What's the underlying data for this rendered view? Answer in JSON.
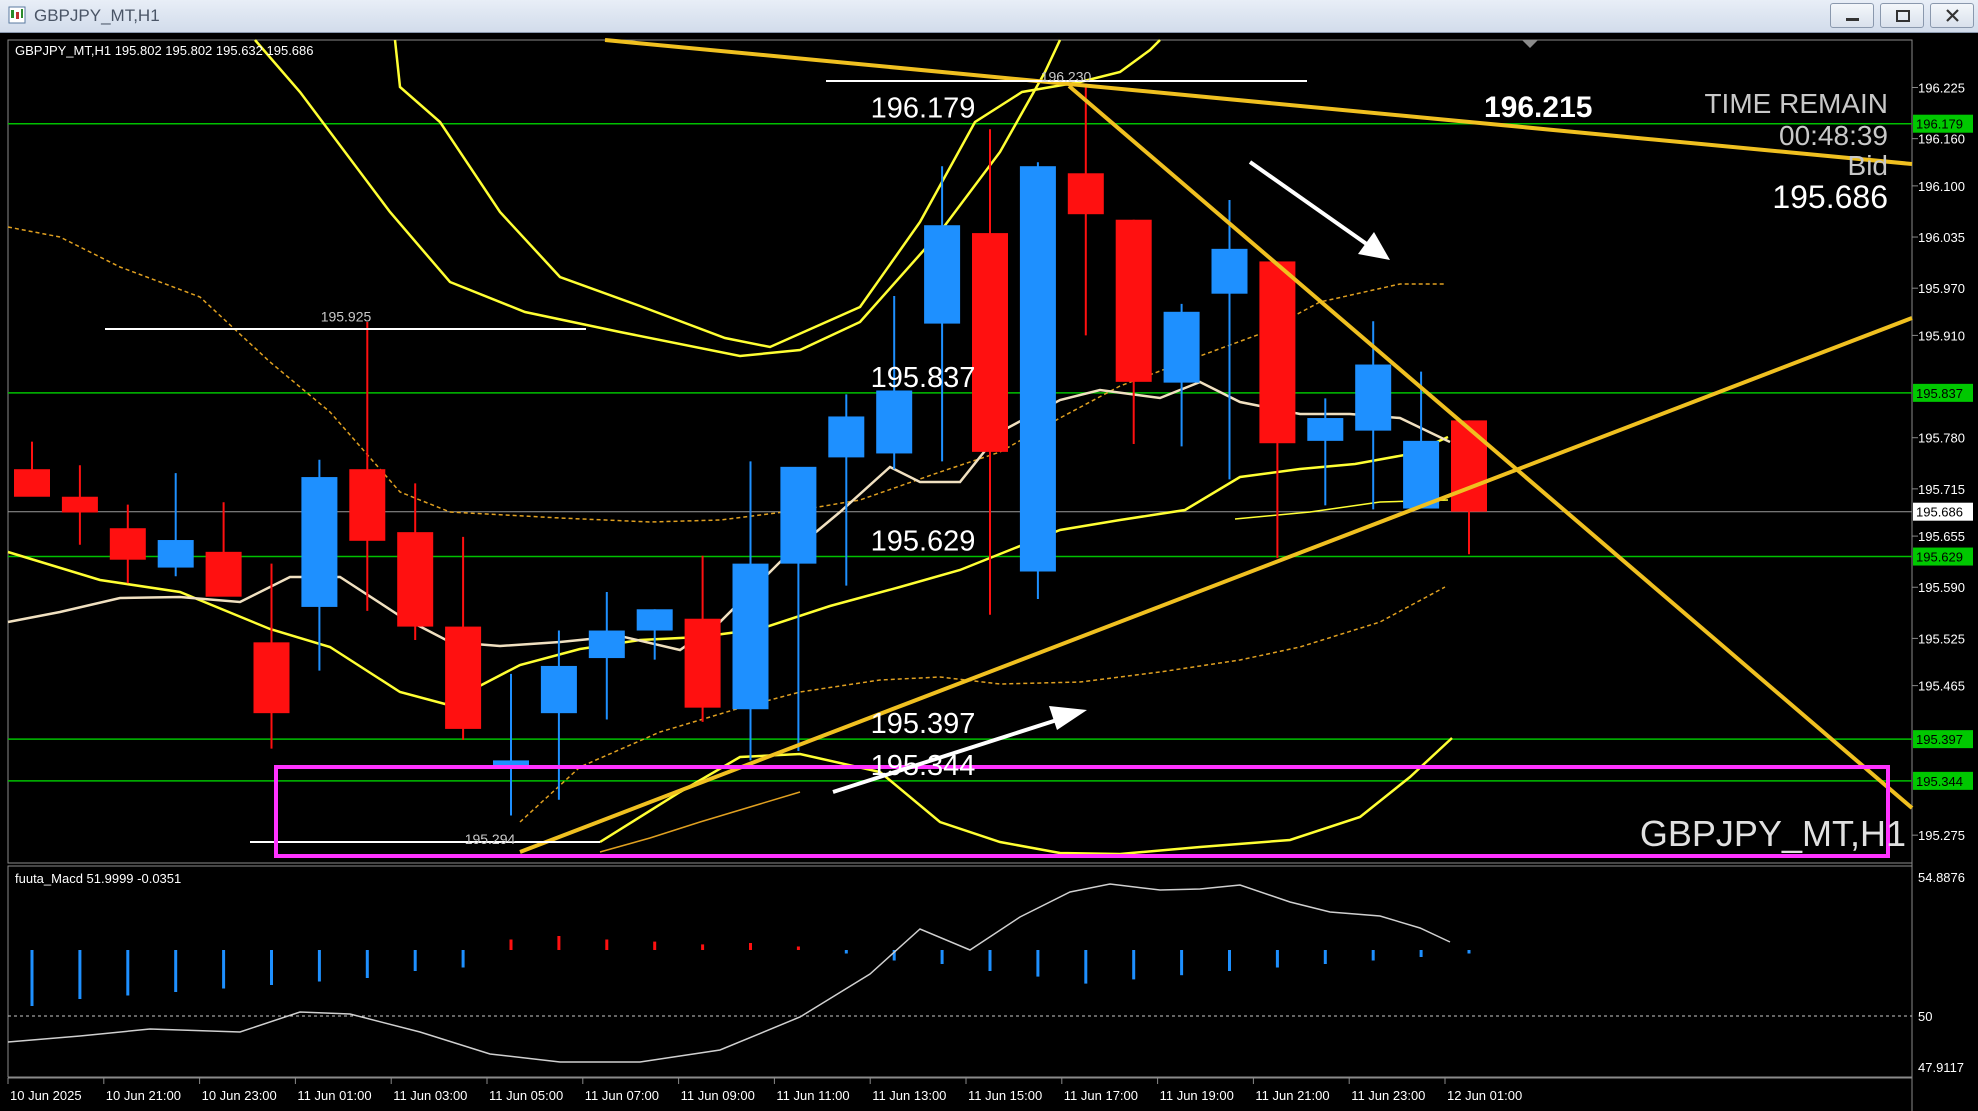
{
  "window": {
    "title": "GBPJPY_MT,H1"
  },
  "header": {
    "ohlc": "GBPJPY_MT,H1  195.802 195.802 195.632 195.686"
  },
  "info": {
    "time_label": "TIME REMAIN",
    "time_value": "00:48:39",
    "bid_label": "Bid",
    "bid_value": "195.686",
    "trendline_value": "196.215",
    "symbol_watermark": "GBPJPY_MT,H1"
  },
  "level_labels": [
    {
      "text": "196.179",
      "price": 196.179
    },
    {
      "text": "195.837",
      "price": 195.837
    },
    {
      "text": "195.629",
      "price": 195.629
    },
    {
      "text": "195.397",
      "price": 195.397
    },
    {
      "text": "195.344",
      "price": 195.344
    }
  ],
  "swing_labels": [
    {
      "text": "196.230",
      "price": 196.23
    },
    {
      "text": "195.925",
      "price": 195.925
    },
    {
      "text": "195.294",
      "price": 195.294
    }
  ],
  "price_axis": {
    "ticks": [
      "196.225",
      "196.160",
      "196.100",
      "196.035",
      "195.970",
      "195.910",
      "195.780",
      "195.715",
      "195.655",
      "195.590",
      "195.525",
      "195.465",
      "195.275"
    ],
    "tick_values": [
      196.225,
      196.16,
      196.1,
      196.035,
      195.97,
      195.91,
      195.78,
      195.715,
      195.655,
      195.59,
      195.525,
      195.465,
      195.275
    ],
    "badges": [
      {
        "text": "196.179",
        "price": 196.179,
        "color": "#00c800"
      },
      {
        "text": "195.837",
        "price": 195.837,
        "color": "#00c800"
      },
      {
        "text": "195.686",
        "price": 195.686,
        "color": "#ffffff"
      },
      {
        "text": "195.629",
        "price": 195.629,
        "color": "#00c800"
      },
      {
        "text": "195.397",
        "price": 195.397,
        "color": "#00c800"
      },
      {
        "text": "195.344",
        "price": 195.344,
        "color": "#00c800"
      }
    ]
  },
  "time_axis": {
    "labels": [
      "10 Jun 2025",
      "10 Jun 21:00",
      "10 Jun 23:00",
      "11 Jun 01:00",
      "11 Jun 03:00",
      "11 Jun 05:00",
      "11 Jun 07:00",
      "11 Jun 09:00",
      "11 Jun 11:00",
      "11 Jun 13:00",
      "11 Jun 15:00",
      "11 Jun 17:00",
      "11 Jun 19:00",
      "11 Jun 21:00",
      "11 Jun 23:00",
      "12 Jun 01:00"
    ]
  },
  "macd": {
    "label": "fuuta_Macd 51.9999  -0.0351",
    "ticks": [
      "54.8876",
      "50",
      "47.9117"
    ],
    "tick_values": [
      54.8876,
      50,
      47.9117
    ]
  },
  "colors": {
    "bull": "#1e90ff",
    "bear": "#ff1010",
    "level": "#00c000",
    "trend": "#f0c020",
    "band": "#ffff33",
    "zone": "#ff33ff",
    "ma": "#f0e0c0"
  },
  "chart_data": {
    "type": "candlestick",
    "x": [
      "10 Jun 19:00",
      "10 Jun 20:00",
      "10 Jun 21:00",
      "10 Jun 22:00",
      "10 Jun 23:00",
      "11 Jun 00:00",
      "11 Jun 01:00",
      "11 Jun 02:00",
      "11 Jun 03:00",
      "11 Jun 04:00",
      "11 Jun 05:00",
      "11 Jun 06:00",
      "11 Jun 07:00",
      "11 Jun 08:00",
      "11 Jun 09:00",
      "11 Jun 10:00",
      "11 Jun 11:00",
      "11 Jun 12:00",
      "11 Jun 13:00",
      "11 Jun 14:00",
      "11 Jun 15:00",
      "11 Jun 16:00",
      "11 Jun 17:00",
      "11 Jun 18:00",
      "11 Jun 19:00",
      "11 Jun 20:00",
      "11 Jun 21:00",
      "11 Jun 22:00",
      "11 Jun 23:00",
      "12 Jun 00:00",
      "12 Jun 01:00"
    ],
    "open": [
      195.74,
      195.705,
      195.665,
      195.615,
      195.635,
      195.52,
      195.565,
      195.74,
      195.66,
      195.54,
      195.36,
      195.43,
      195.5,
      195.535,
      195.55,
      195.435,
      195.62,
      195.755,
      195.76,
      195.925,
      196.04,
      195.61,
      196.116,
      196.057,
      195.85,
      195.963,
      196.004,
      195.776,
      195.789,
      195.69,
      195.802
    ],
    "high": [
      195.775,
      195.745,
      195.695,
      195.735,
      195.698,
      195.62,
      195.752,
      195.927,
      195.722,
      195.654,
      195.48,
      195.535,
      195.584,
      195.562,
      195.63,
      195.75,
      195.72,
      195.835,
      195.96,
      196.125,
      196.172,
      196.13,
      196.23,
      196.057,
      195.95,
      196.082,
      196.004,
      195.83,
      195.928,
      195.864,
      195.802
    ],
    "low": [
      195.725,
      195.644,
      195.595,
      195.604,
      195.6,
      195.385,
      195.484,
      195.56,
      195.523,
      195.396,
      195.3,
      195.32,
      195.422,
      195.498,
      195.419,
      195.37,
      195.382,
      195.592,
      195.74,
      195.75,
      195.555,
      195.575,
      195.91,
      195.772,
      195.769,
      195.727,
      195.627,
      195.694,
      195.689,
      195.696,
      195.632
    ],
    "close": [
      195.705,
      195.685,
      195.625,
      195.65,
      195.578,
      195.43,
      195.73,
      195.649,
      195.54,
      195.41,
      195.37,
      195.49,
      195.535,
      195.562,
      195.437,
      195.62,
      195.743,
      195.807,
      195.84,
      196.05,
      195.762,
      196.125,
      196.064,
      195.851,
      195.94,
      196.02,
      195.773,
      195.805,
      195.873,
      195.776,
      195.686
    ],
    "levels": [
      196.179,
      195.837,
      195.629,
      195.397,
      195.344
    ],
    "ylim": [
      195.26,
      196.28
    ]
  }
}
